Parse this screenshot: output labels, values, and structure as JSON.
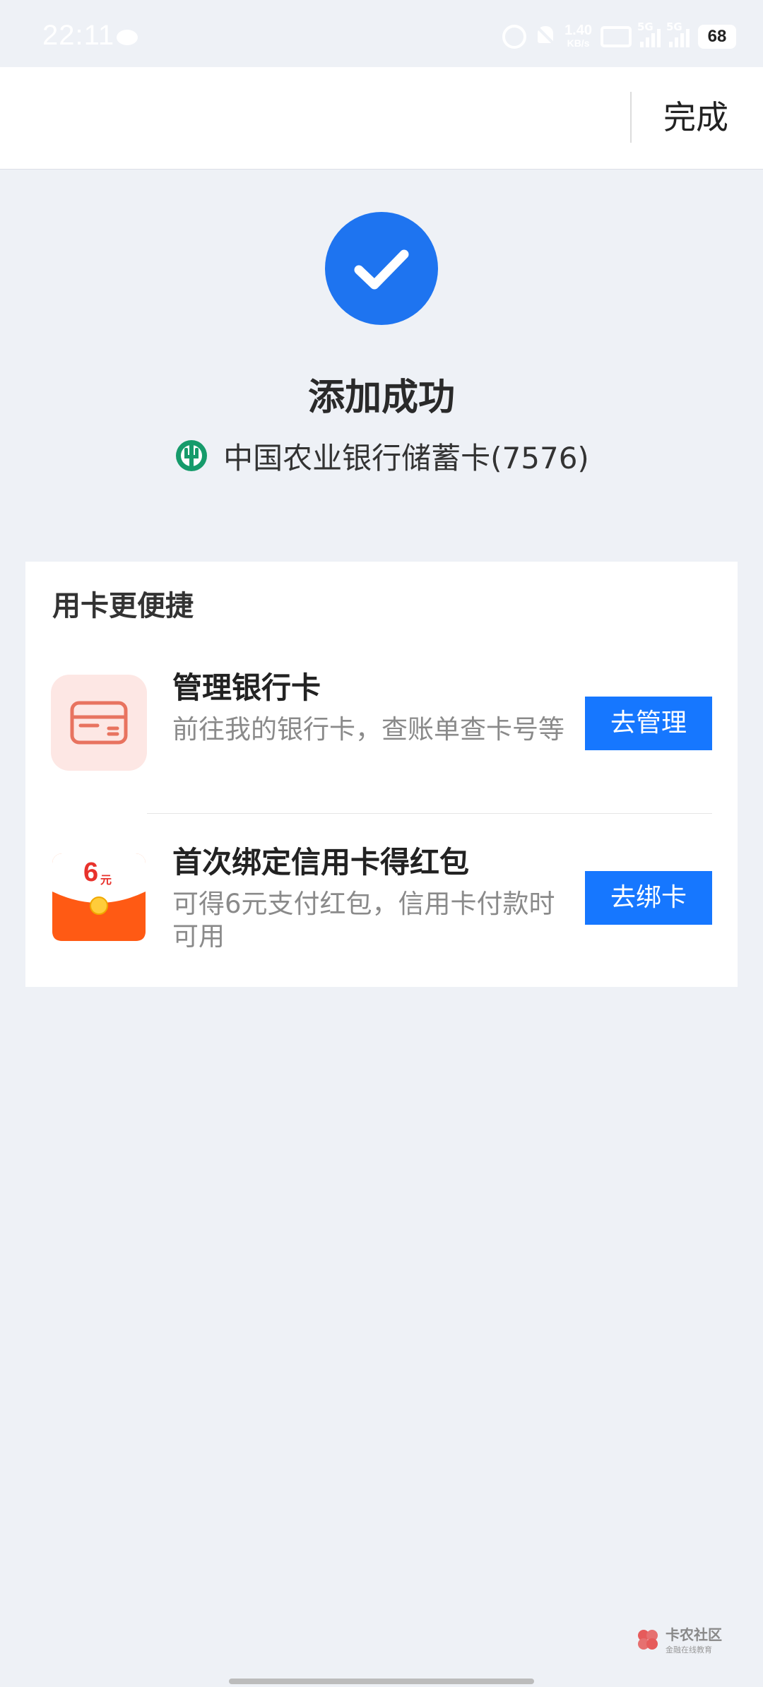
{
  "status_bar": {
    "time": "22:11",
    "speed_value": "1.40",
    "speed_unit": "KB/s",
    "network_1": "5G",
    "network_2": "5G",
    "battery": "68"
  },
  "header": {
    "done_label": "完成"
  },
  "success": {
    "title": "添加成功",
    "bank_name": "中国农业银行储蓄卡(7576)",
    "accent_color": "#1e74f0"
  },
  "convenience": {
    "title": "用卡更便捷",
    "items": [
      {
        "title": "管理银行卡",
        "description": "前往我的银行卡，查账单查卡号等",
        "button": "去管理",
        "icon": "bank-card-icon"
      },
      {
        "title": "首次绑定信用卡得红包",
        "description": "可得6元支付红包，信用卡付款时可用",
        "button": "去绑卡",
        "icon": "red-packet-icon",
        "badge": "6",
        "badge_unit": "元"
      }
    ]
  },
  "watermark": {
    "main": "卡农社区",
    "sub": "金融在线教育"
  },
  "colors": {
    "button_blue": "#1677ff",
    "page_bg": "#eef1f6"
  }
}
